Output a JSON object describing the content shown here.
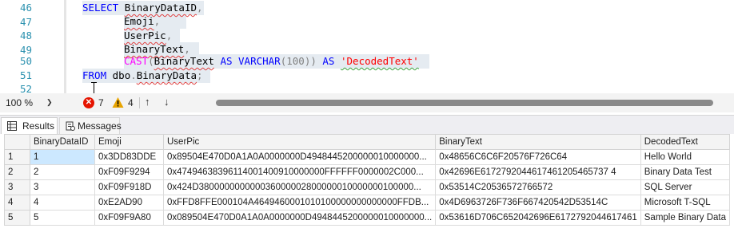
{
  "editor": {
    "line_numbers": [
      "46",
      "47",
      "48",
      "49",
      "50",
      "51",
      "52"
    ],
    "lines": {
      "l46": {
        "select_kw": "SELECT",
        "col": "BinaryDataID",
        "comma": ","
      },
      "l47": {
        "col": "Emoji",
        "comma": ","
      },
      "l48": {
        "col": "UserPic",
        "comma": ","
      },
      "l49": {
        "col": "BinaryText",
        "comma": ","
      },
      "l50": {
        "cast_fn": "CAST",
        "open": "(",
        "col": "BinaryText",
        "as1": "AS",
        "type": "VARCHAR",
        "len": "(100))",
        "as2": "AS",
        "alias": "'DecodedText'"
      },
      "l51": {
        "from_kw": "FROM",
        "schema": "dbo",
        "dot": ".",
        "table": "BinaryData",
        "semi": ";"
      }
    }
  },
  "status": {
    "zoom": "100 %",
    "errors_icon": "error-icon",
    "errors": "7",
    "warnings_icon": "warning-icon",
    "warnings": "4",
    "error_color": "#e51400",
    "warning_color": "#e8a400"
  },
  "tabs": [
    {
      "label": "Results",
      "icon": "grid-icon"
    },
    {
      "label": "Messages",
      "icon": "messages-icon"
    }
  ],
  "grid": {
    "columns": [
      "BinaryDataID",
      "Emoji",
      "UserPic",
      "BinaryText",
      "DecodedText"
    ],
    "rows": [
      {
        "n": "1",
        "BinaryDataID": "1",
        "Emoji": "0x3DD83DDE",
        "UserPic": "0x89504E470D0A1A0A0000000D4948445200000010000000...",
        "BinaryText": "0x48656C6C6F20576F726C64",
        "DecodedText": "Hello World"
      },
      {
        "n": "2",
        "BinaryDataID": "2",
        "Emoji": "0xF09F9294",
        "UserPic": "0x47494638396114001400910000000FFFFFF0000002C000...",
        "BinaryText": "0x42696E6172792044617461205465737 4",
        "DecodedText": "Binary Data Test"
      },
      {
        "n": "3",
        "BinaryDataID": "3",
        "Emoji": "0xF09F918D",
        "UserPic": "0x424D380000000000036000002800000010000000100000...",
        "BinaryText": "0x53514C20536572766572",
        "DecodedText": "SQL Server"
      },
      {
        "n": "4",
        "BinaryDataID": "4",
        "Emoji": "0xE2AD90",
        "UserPic": "0xFFD8FFE000104A4649460001010100000000000000FFDB...",
        "BinaryText": "0x4D6963726F736F667420542D53514C",
        "DecodedText": "Microsoft T-SQL"
      },
      {
        "n": "5",
        "BinaryDataID": "5",
        "Emoji": "0xF09F9A80",
        "UserPic": "0x089504E470D0A1A0A0000000D4948445200000010000000...",
        "BinaryText": "0x53616D706C652042696E6172792044617461",
        "DecodedText": "Sample Binary Data"
      }
    ]
  }
}
